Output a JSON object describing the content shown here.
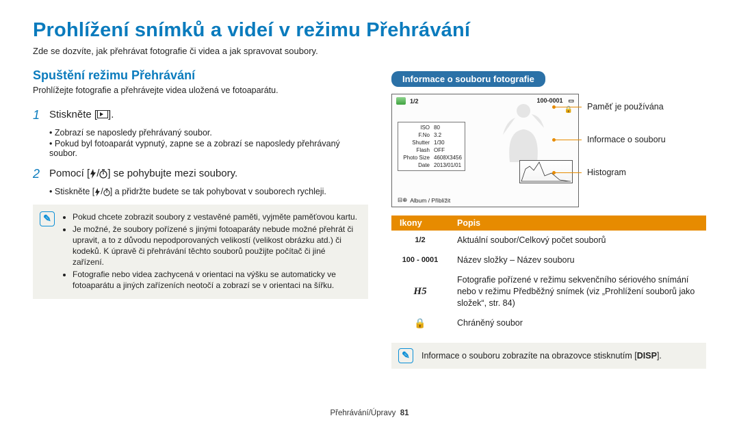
{
  "title": "Prohlížení snímků a videí v režimu Přehrávání",
  "intro": "Zde se dozvíte, jak přehrávat fotografie či videa a jak spravovat soubory.",
  "section": {
    "heading": "Spuštění režimu Přehrávání",
    "desc": "Prohlížejte fotografie a přehrávejte videa uložená ve fotoaparátu."
  },
  "step1": {
    "num": "1",
    "pre": "Stiskněte [",
    "post": "].",
    "sub1": "Zobrazí se naposledy přehrávaný soubor.",
    "sub2": "Pokud byl fotoaparát vypnutý, zapne se a zobrazí se naposledy přehrávaný soubor."
  },
  "step2": {
    "num": "2",
    "pre": "Pomocí [",
    "mid": "/",
    "post": "] se pohybujte mezi soubory.",
    "sub_pre": "Stiskněte [",
    "sub_mid": "/",
    "sub_post": "] a přidržte budete se tak pohybovat v souborech rychleji."
  },
  "notebox1": {
    "li1": "Pokud chcete zobrazit soubory z vestavěné paměti, vyjměte paměťovou kartu.",
    "li2": "Je možné, že soubory pořízené s jinými fotoaparáty nebude možné přehrát či upravit, a to z důvodu nepodporovaných velikostí (velikost obrázku atd.) či kodeků. K úpravě či přehrávání těchto souborů použijte počítač či jiné zařízení.",
    "li3": "Fotografie nebo videa zachycená v orientaci na výšku se automaticky ve fotoaparátu a jiných zařízeních neotočí a zobrazí se v orientaci na šířku."
  },
  "badge": "Informace o souboru fotografie",
  "lcd": {
    "counter": "1/2",
    "file": "100-0001",
    "memory_icon_title": "Paměť je používána",
    "lock": "🔒",
    "exif": {
      "iso_l": "ISO",
      "iso_v": "80",
      "fno_l": "F.No",
      "fno_v": "3.2",
      "shutter_l": "Shutter",
      "shutter_v": "1/30",
      "flash_l": "Flash",
      "flash_v": "OFF",
      "size_l": "Photo Size",
      "size_v": "4608X3456",
      "date_l": "Date",
      "date_v": "2013/01/01"
    },
    "bottom": "Album / Přiblížit"
  },
  "callouts": {
    "memory": "Paměť je používána",
    "info": "Informace o souboru",
    "hist": "Histogram"
  },
  "table": {
    "h1": "Ikony",
    "h2": "Popis",
    "r1_icon": "1/2",
    "r1_desc": "Aktuální soubor/Celkový počet souborů",
    "r2_icon": "100 - 0001",
    "r2_desc": "Název složky – Název souboru",
    "r3_icon": "H5",
    "r3_desc": "Fotografie pořízené v režimu sekvenčního sériového snímání nebo v režimu Předběžný snímek (viz „Prohlížení souborů jako složek“, str. 84)",
    "r4_icon": "🔒",
    "r4_desc": "Chráněný soubor"
  },
  "notebox2_pre": "Informace o souboru zobrazíte na obrazovce stisknutím [",
  "notebox2_key": "DISP",
  "notebox2_post": "].",
  "footer": {
    "section": "Přehrávání/Úpravy",
    "page": "81"
  }
}
